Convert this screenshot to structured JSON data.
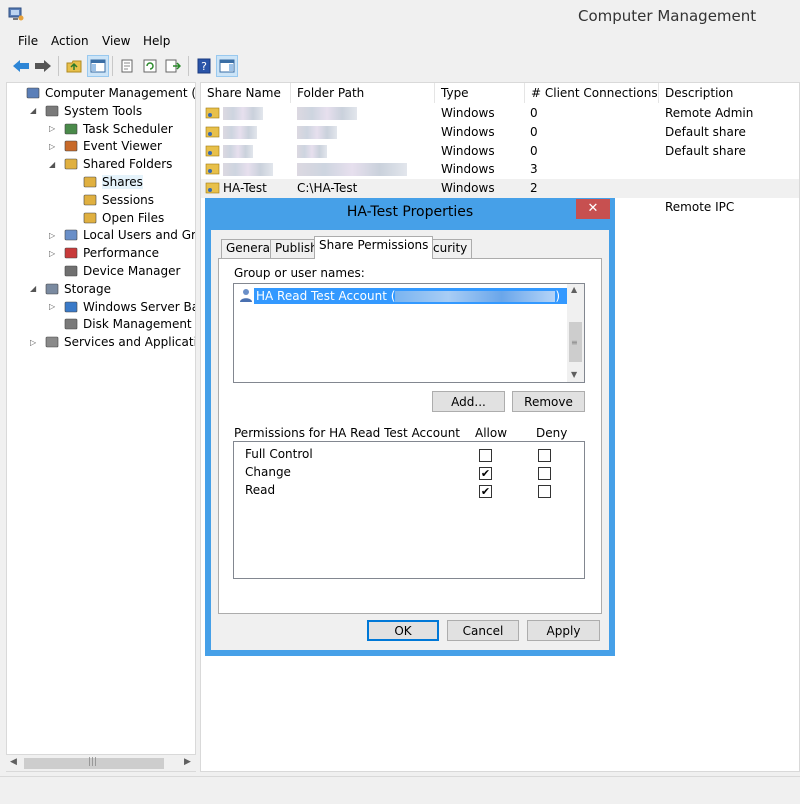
{
  "window": {
    "title": "Computer Management"
  },
  "menu": [
    "File",
    "Action",
    "View",
    "Help"
  ],
  "tree": [
    {
      "label": "Computer Management (SQUF",
      "level": 0,
      "expander": ""
    },
    {
      "label": "System Tools",
      "level": 1,
      "expander": "◢"
    },
    {
      "label": "Task Scheduler",
      "level": 2,
      "expander": "▷"
    },
    {
      "label": "Event Viewer",
      "level": 2,
      "expander": "▷"
    },
    {
      "label": "Shared Folders",
      "level": 2,
      "expander": "◢"
    },
    {
      "label": "Shares",
      "level": 3,
      "expander": ""
    },
    {
      "label": "Sessions",
      "level": 3,
      "expander": ""
    },
    {
      "label": "Open Files",
      "level": 3,
      "expander": ""
    },
    {
      "label": "Local Users and Groups",
      "level": 2,
      "expander": "▷"
    },
    {
      "label": "Performance",
      "level": 2,
      "expander": "▷"
    },
    {
      "label": "Device Manager",
      "level": 2,
      "expander": ""
    },
    {
      "label": "Storage",
      "level": 1,
      "expander": "◢"
    },
    {
      "label": "Windows Server Backup",
      "level": 2,
      "expander": "▷"
    },
    {
      "label": "Disk Management",
      "level": 2,
      "expander": ""
    },
    {
      "label": "Services and Applications",
      "level": 1,
      "expander": "▷"
    }
  ],
  "columns": [
    "Share Name",
    "Folder Path",
    "Type",
    "# Client Connections",
    "Description"
  ],
  "rows": [
    {
      "name": "",
      "path": "",
      "type": "Windows",
      "connections": "0",
      "description": "Remote Admin"
    },
    {
      "name": "",
      "path": "",
      "type": "Windows",
      "connections": "0",
      "description": "Default share"
    },
    {
      "name": "",
      "path": "",
      "type": "Windows",
      "connections": "0",
      "description": "Default share"
    },
    {
      "name": "",
      "path": "",
      "type": "Windows",
      "connections": "3",
      "description": ""
    },
    {
      "name": "HA-Test",
      "path": "C:\\HA-Test",
      "type": "Windows",
      "connections": "2",
      "description": ""
    },
    {
      "name": "",
      "path": "",
      "type": "",
      "connections": "",
      "description": "Remote IPC"
    }
  ],
  "dialog": {
    "title": "HA-Test Properties",
    "close": "✕",
    "tabs": [
      "General",
      "Publish",
      "Share Permissions",
      "Security"
    ],
    "group_label": "Group or user names:",
    "selected_user": "HA Read Test Account (",
    "selected_user_suffix": ")",
    "add_button": "Add...",
    "remove_button": "Remove",
    "permissions_label": "Permissions for HA Read Test Account",
    "allow_label": "Allow",
    "deny_label": "Deny",
    "permissions": [
      {
        "name": "Full Control",
        "allow": false,
        "deny": false
      },
      {
        "name": "Change",
        "allow": true,
        "deny": false
      },
      {
        "name": "Read",
        "allow": true,
        "deny": false
      }
    ],
    "ok_button": "OK",
    "cancel_button": "Cancel",
    "apply_button": "Apply"
  }
}
